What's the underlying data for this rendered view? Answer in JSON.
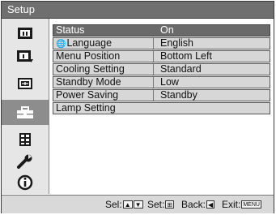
{
  "title": "Setup",
  "sidebar": {
    "items": [
      {
        "icon": "picture-icon"
      },
      {
        "icon": "picture-adjust-icon"
      },
      {
        "icon": "screen-icon"
      },
      {
        "icon": "setup-toolbox-icon"
      },
      {
        "icon": "function-list-icon"
      },
      {
        "icon": "wrench-icon"
      },
      {
        "icon": "info-icon"
      }
    ],
    "selected_index": 3
  },
  "menu": {
    "rows": [
      {
        "label": "Status",
        "value": "On"
      },
      {
        "label": "Language",
        "value": "English"
      },
      {
        "label": "Menu Position",
        "value": "Bottom Left"
      },
      {
        "label": "Cooling Setting",
        "value": "Standard"
      },
      {
        "label": "Standby Mode",
        "value": "Low"
      },
      {
        "label": "Power Saving",
        "value": "Standby"
      },
      {
        "label": "Lamp Setting",
        "value": ""
      }
    ],
    "selected_index": 0
  },
  "status_bar": {
    "sel_label": "Sel:",
    "set_label": "Set:",
    "back_label": "Back:",
    "exit_label": "Exit:",
    "exit_key": "MENU"
  },
  "colors": {
    "title_bar": "#6f6f6f",
    "sidebar": "#e6e6e6",
    "selected": "#6a6a6a",
    "row": "#d7d7d7",
    "status_bar": "#d9d9d9"
  }
}
